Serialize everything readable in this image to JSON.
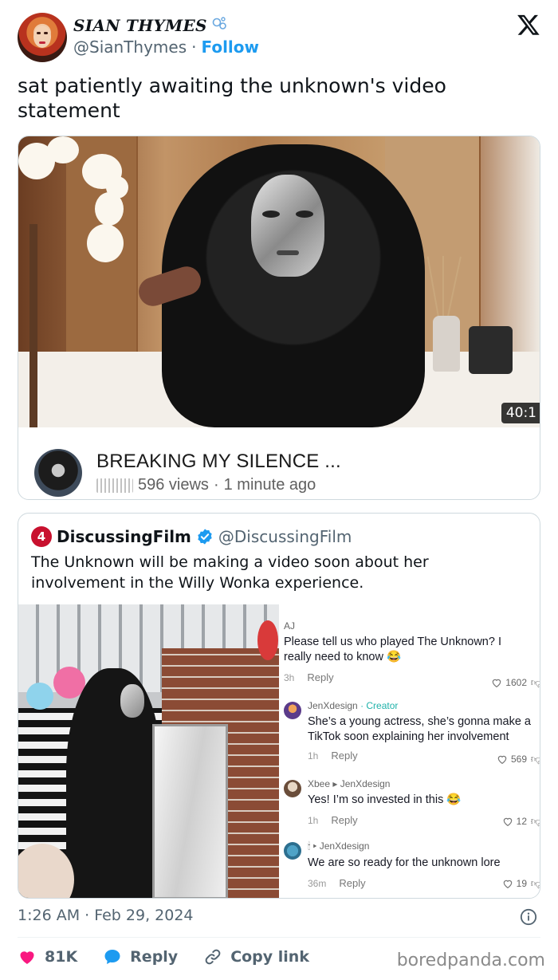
{
  "author": {
    "display_name": "SIAN THYMES",
    "badge_icon": "bubbles-icon",
    "handle": "@SianThymes",
    "separator": "·",
    "follow_label": "Follow"
  },
  "tweet": {
    "text": "sat patiently awaiting the unknown's video statement",
    "timestamp": "1:26 AM · Feb 29, 2024"
  },
  "video_card": {
    "duration": "40:1",
    "title": "BREAKING MY SILENCE ...",
    "views": "596 views",
    "separator": "·",
    "age": "1 minute ago"
  },
  "quote": {
    "name": "DiscussingFilm",
    "handle": "@DiscussingFilm",
    "text": "The Unknown will be making a video soon about her involvement in the Willy Wonka experience.",
    "comments": [
      {
        "user": "AJ",
        "tag": "",
        "reply_to": "",
        "text": "Please tell us who played The Unknown? I really need to know 😂",
        "age": "3h",
        "reply": "Reply",
        "likes": "1602"
      },
      {
        "user": "JenXdesign",
        "tag": "· Creator",
        "reply_to": "",
        "text": "She’s a young actress, she’s gonna make a TikTok soon explaining her involvement",
        "age": "1h",
        "reply": "Reply",
        "likes": "569"
      },
      {
        "user": "Xbee",
        "tag": "",
        "reply_to": "JenXdesign",
        "text": "Yes! I’m so invested in this 😂",
        "age": "1h",
        "reply": "Reply",
        "likes": "12"
      },
      {
        "user": "🕯",
        "tag": "",
        "reply_to": "JenXdesign",
        "text": "We are so ready for the unknown lore",
        "age": "36m",
        "reply": "Reply",
        "likes": "19"
      }
    ]
  },
  "actions": {
    "likes": "81K",
    "reply_label": "Reply",
    "copy_label": "Copy link"
  },
  "watermark": "boredpanda.com",
  "colors": {
    "accent": "#1d9bf0",
    "like": "#f91880",
    "muted": "#536471"
  }
}
